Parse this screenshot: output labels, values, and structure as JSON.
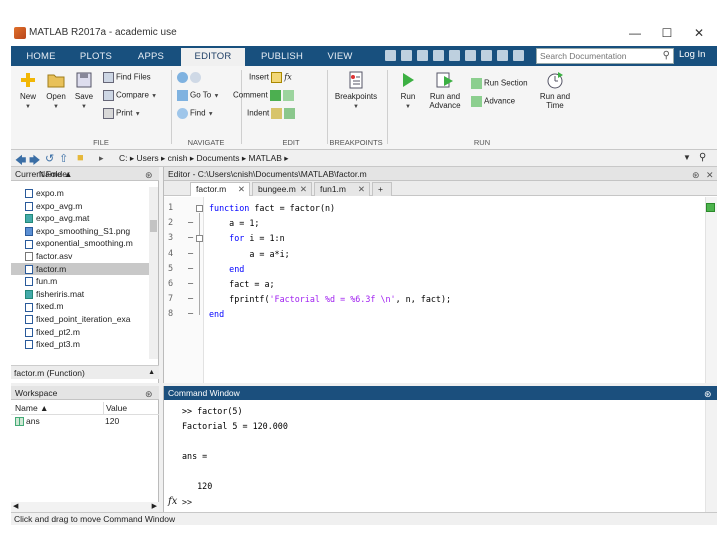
{
  "window": {
    "title": "MATLAB R2017a - academic use",
    "minimize_glyph": "—",
    "maximize_glyph": "☐",
    "close_glyph": "✕"
  },
  "ribbon": {
    "tabs": [
      "HOME",
      "PLOTS",
      "APPS",
      "EDITOR",
      "PUBLISH",
      "VIEW"
    ],
    "active_tab": "EDITOR",
    "search_placeholder": "Search Documentation",
    "login_label": "Log In"
  },
  "toolstrip": {
    "file": {
      "label": "FILE",
      "new": "New",
      "open": "Open",
      "save": "Save",
      "find_files": "Find Files",
      "compare": "Compare",
      "print": "Print"
    },
    "navigate": {
      "label": "NAVIGATE",
      "go_to": "Go To",
      "find": "Find"
    },
    "edit": {
      "label": "EDIT",
      "insert": "Insert",
      "comment": "Comment",
      "indent": "Indent"
    },
    "breakpoints": {
      "label": "BREAKPOINTS",
      "button": "Breakpoints"
    },
    "run": {
      "label": "RUN",
      "run": "Run",
      "run_and_advance_1": "Run and",
      "run_and_advance_2": "Advance",
      "run_section": "Run Section",
      "advance": "Advance",
      "run_and_time_1": "Run and",
      "run_and_time_2": "Time"
    }
  },
  "address": {
    "path": "C: ▸ Users ▸ cnish ▸ Documents ▸ MATLAB ▸"
  },
  "current_folder": {
    "title": "Current Folder",
    "column": "Name ▲",
    "files": [
      {
        "name": "expo.m",
        "type": "m"
      },
      {
        "name": "expo_avg.m",
        "type": "m"
      },
      {
        "name": "expo_avg.mat",
        "type": "mat"
      },
      {
        "name": "expo_smoothing_S1.png",
        "type": "img"
      },
      {
        "name": "exponential_smoothing.m",
        "type": "m"
      },
      {
        "name": "factor.asv",
        "type": "other"
      },
      {
        "name": "factor.m",
        "type": "m"
      },
      {
        "name": "fun.m",
        "type": "m"
      },
      {
        "name": "fisheriris.mat",
        "type": "mat"
      },
      {
        "name": "fixed.m",
        "type": "m"
      },
      {
        "name": "fixed_point_iteration_exa",
        "type": "m"
      },
      {
        "name": "fixed_pt2.m",
        "type": "m"
      },
      {
        "name": "fixed_pt3.m",
        "type": "m"
      }
    ],
    "selected_index": 6,
    "details": "factor.m (Function)"
  },
  "workspace": {
    "title": "Workspace",
    "col_name": "Name ▲",
    "col_value": "Value",
    "rows": [
      {
        "name": "ans",
        "value": "120"
      }
    ]
  },
  "editor": {
    "title": "Editor - C:\\Users\\cnish\\Documents\\MATLAB\\factor.m",
    "tabs": [
      "factor.m",
      "bungee.m",
      "fun1.m"
    ],
    "add_tab": "+",
    "lines": [
      {
        "n": "1",
        "dash": "",
        "parts": [
          {
            "t": "function ",
            "c": "kw"
          },
          {
            "t": "fact = factor(n)",
            "c": ""
          }
        ]
      },
      {
        "n": "2",
        "dash": "—",
        "parts": [
          {
            "t": "    a = 1;",
            "c": ""
          }
        ]
      },
      {
        "n": "3",
        "dash": "—",
        "parts": [
          {
            "t": "    ",
            "c": ""
          },
          {
            "t": "for ",
            "c": "kw"
          },
          {
            "t": "i = 1:n",
            "c": ""
          }
        ]
      },
      {
        "n": "4",
        "dash": "—",
        "parts": [
          {
            "t": "        a = a*i;",
            "c": ""
          }
        ]
      },
      {
        "n": "5",
        "dash": "—",
        "parts": [
          {
            "t": "    ",
            "c": ""
          },
          {
            "t": "end",
            "c": "kw"
          }
        ]
      },
      {
        "n": "6",
        "dash": "—",
        "parts": [
          {
            "t": "    fact = a;",
            "c": ""
          }
        ]
      },
      {
        "n": "7",
        "dash": "—",
        "parts": [
          {
            "t": "    fprintf(",
            "c": ""
          },
          {
            "t": "'Factorial %d = %6.3f \\n'",
            "c": "str"
          },
          {
            "t": ", n, fact);",
            "c": ""
          }
        ]
      },
      {
        "n": "8",
        "dash": "—",
        "parts": [
          {
            "t": "end",
            "c": "kw"
          }
        ]
      }
    ]
  },
  "command_window": {
    "title": "Command Window",
    "lines": [
      ">> factor(5)",
      "Factorial 5 = 120.000",
      "",
      "ans =",
      "",
      "   120"
    ],
    "prompt": ">>"
  },
  "status": {
    "text": "Click and drag to move Command Window"
  },
  "colors": {
    "tab_strip": "#18507e",
    "command_header": "#1b4f7d",
    "keyword": "#0000ff",
    "string": "#a020f0"
  }
}
